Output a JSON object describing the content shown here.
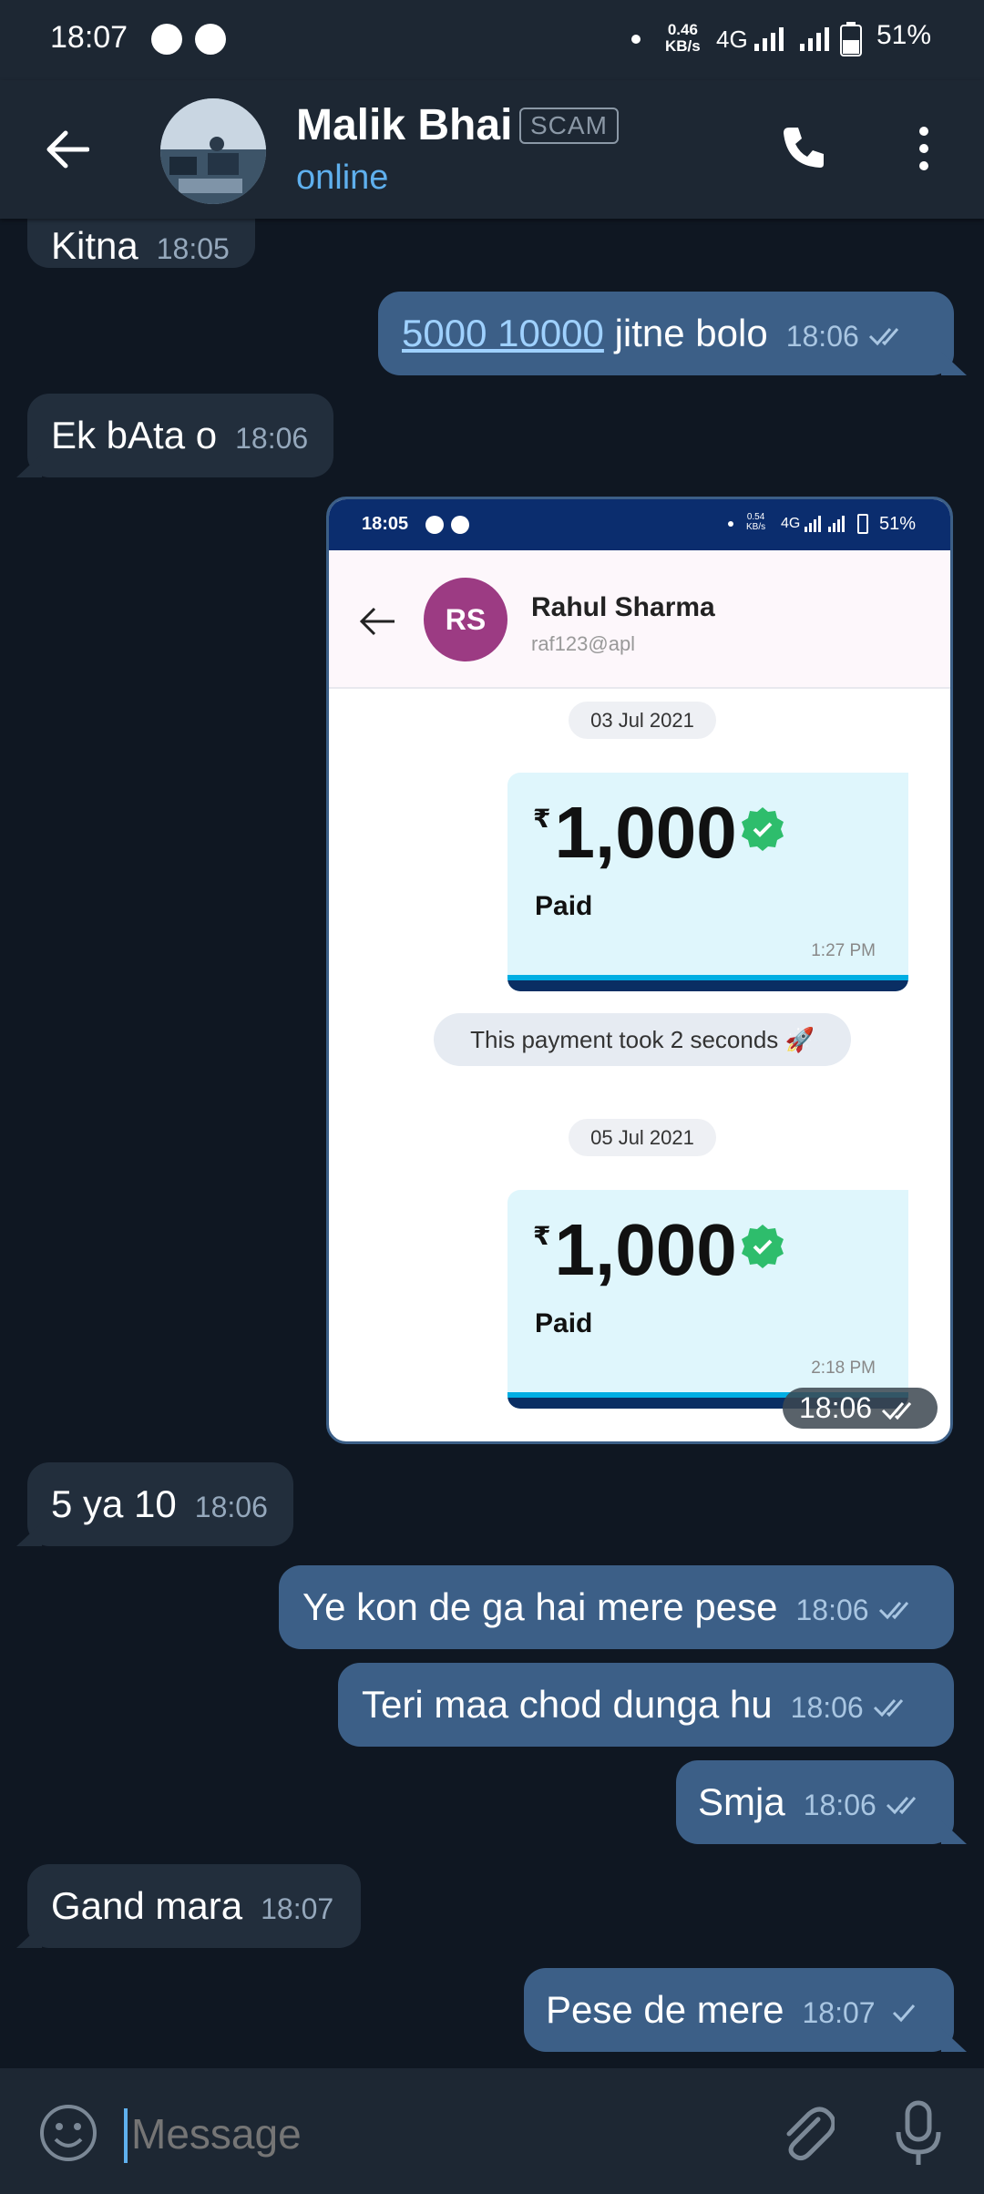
{
  "status_bar": {
    "time": "18:07",
    "net_speed_top": "0.46",
    "net_speed_unit": "KB/s",
    "network": "4G",
    "battery": "51%"
  },
  "header": {
    "contact_name": "Malik Bhai",
    "badge": "SCAM",
    "status": "online"
  },
  "messages": [
    {
      "dir": "in",
      "text": "Kitna",
      "time": "18:05"
    },
    {
      "dir": "out",
      "text_link": "5000 10000",
      "text": " jitne bolo",
      "time": "18:06"
    },
    {
      "dir": "in",
      "text": "Ek bAta o",
      "time": "18:06"
    },
    {
      "dir": "in",
      "text": "5 ya 10",
      "time": "18:06"
    },
    {
      "dir": "out",
      "text": "Ye kon de ga hai mere pese",
      "time": "18:06"
    },
    {
      "dir": "out",
      "text": "Teri maa chod dunga hu",
      "time": "18:06"
    },
    {
      "dir": "out",
      "text": "Smja",
      "time": "18:06"
    },
    {
      "dir": "in",
      "text": "Gand mara",
      "time": "18:07"
    },
    {
      "dir": "out",
      "text": "Pese de mere",
      "time": "18:07"
    }
  ],
  "screenshot": {
    "time_stamp": "18:06",
    "status_time": "18:05",
    "status_speed": "0.54",
    "status_speed_unit": "KB/s",
    "status_network": "4G",
    "status_battery": "51%",
    "payee_initials": "RS",
    "payee_name": "Rahul Sharma",
    "payee_upi": "raf123@apl",
    "date1": "03 Jul 2021",
    "amount1": "1,000",
    "currency": "₹",
    "paid1": "Paid",
    "time1": "1:27 PM",
    "note": "This payment took 2 seconds 🚀",
    "date2": "05 Jul 2021",
    "amount2": "1,000",
    "paid2": "Paid",
    "time2": "2:18 PM"
  },
  "input": {
    "placeholder": "Message"
  }
}
